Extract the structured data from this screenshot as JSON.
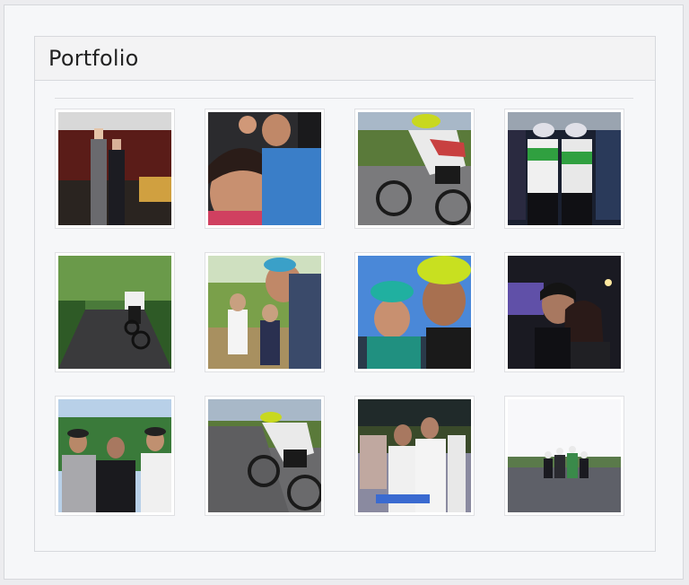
{
  "panel": {
    "title": "Portfolio"
  },
  "photos": [
    {
      "scene": "event-stage"
    },
    {
      "scene": "selfie-car"
    },
    {
      "scene": "cyclist-road"
    },
    {
      "scene": "cycling-team"
    },
    {
      "scene": "cyclist-forest"
    },
    {
      "scene": "family-selfie-trail"
    },
    {
      "scene": "helmet-selfie"
    },
    {
      "scene": "night-selfie"
    },
    {
      "scene": "three-friends"
    },
    {
      "scene": "cyclist-road-2"
    },
    {
      "scene": "skaters-group"
    },
    {
      "scene": "skaters-parking"
    }
  ],
  "colors": {
    "panel_bg": "#f6f7f9",
    "border": "#d7d9dd",
    "title": "#222222"
  }
}
